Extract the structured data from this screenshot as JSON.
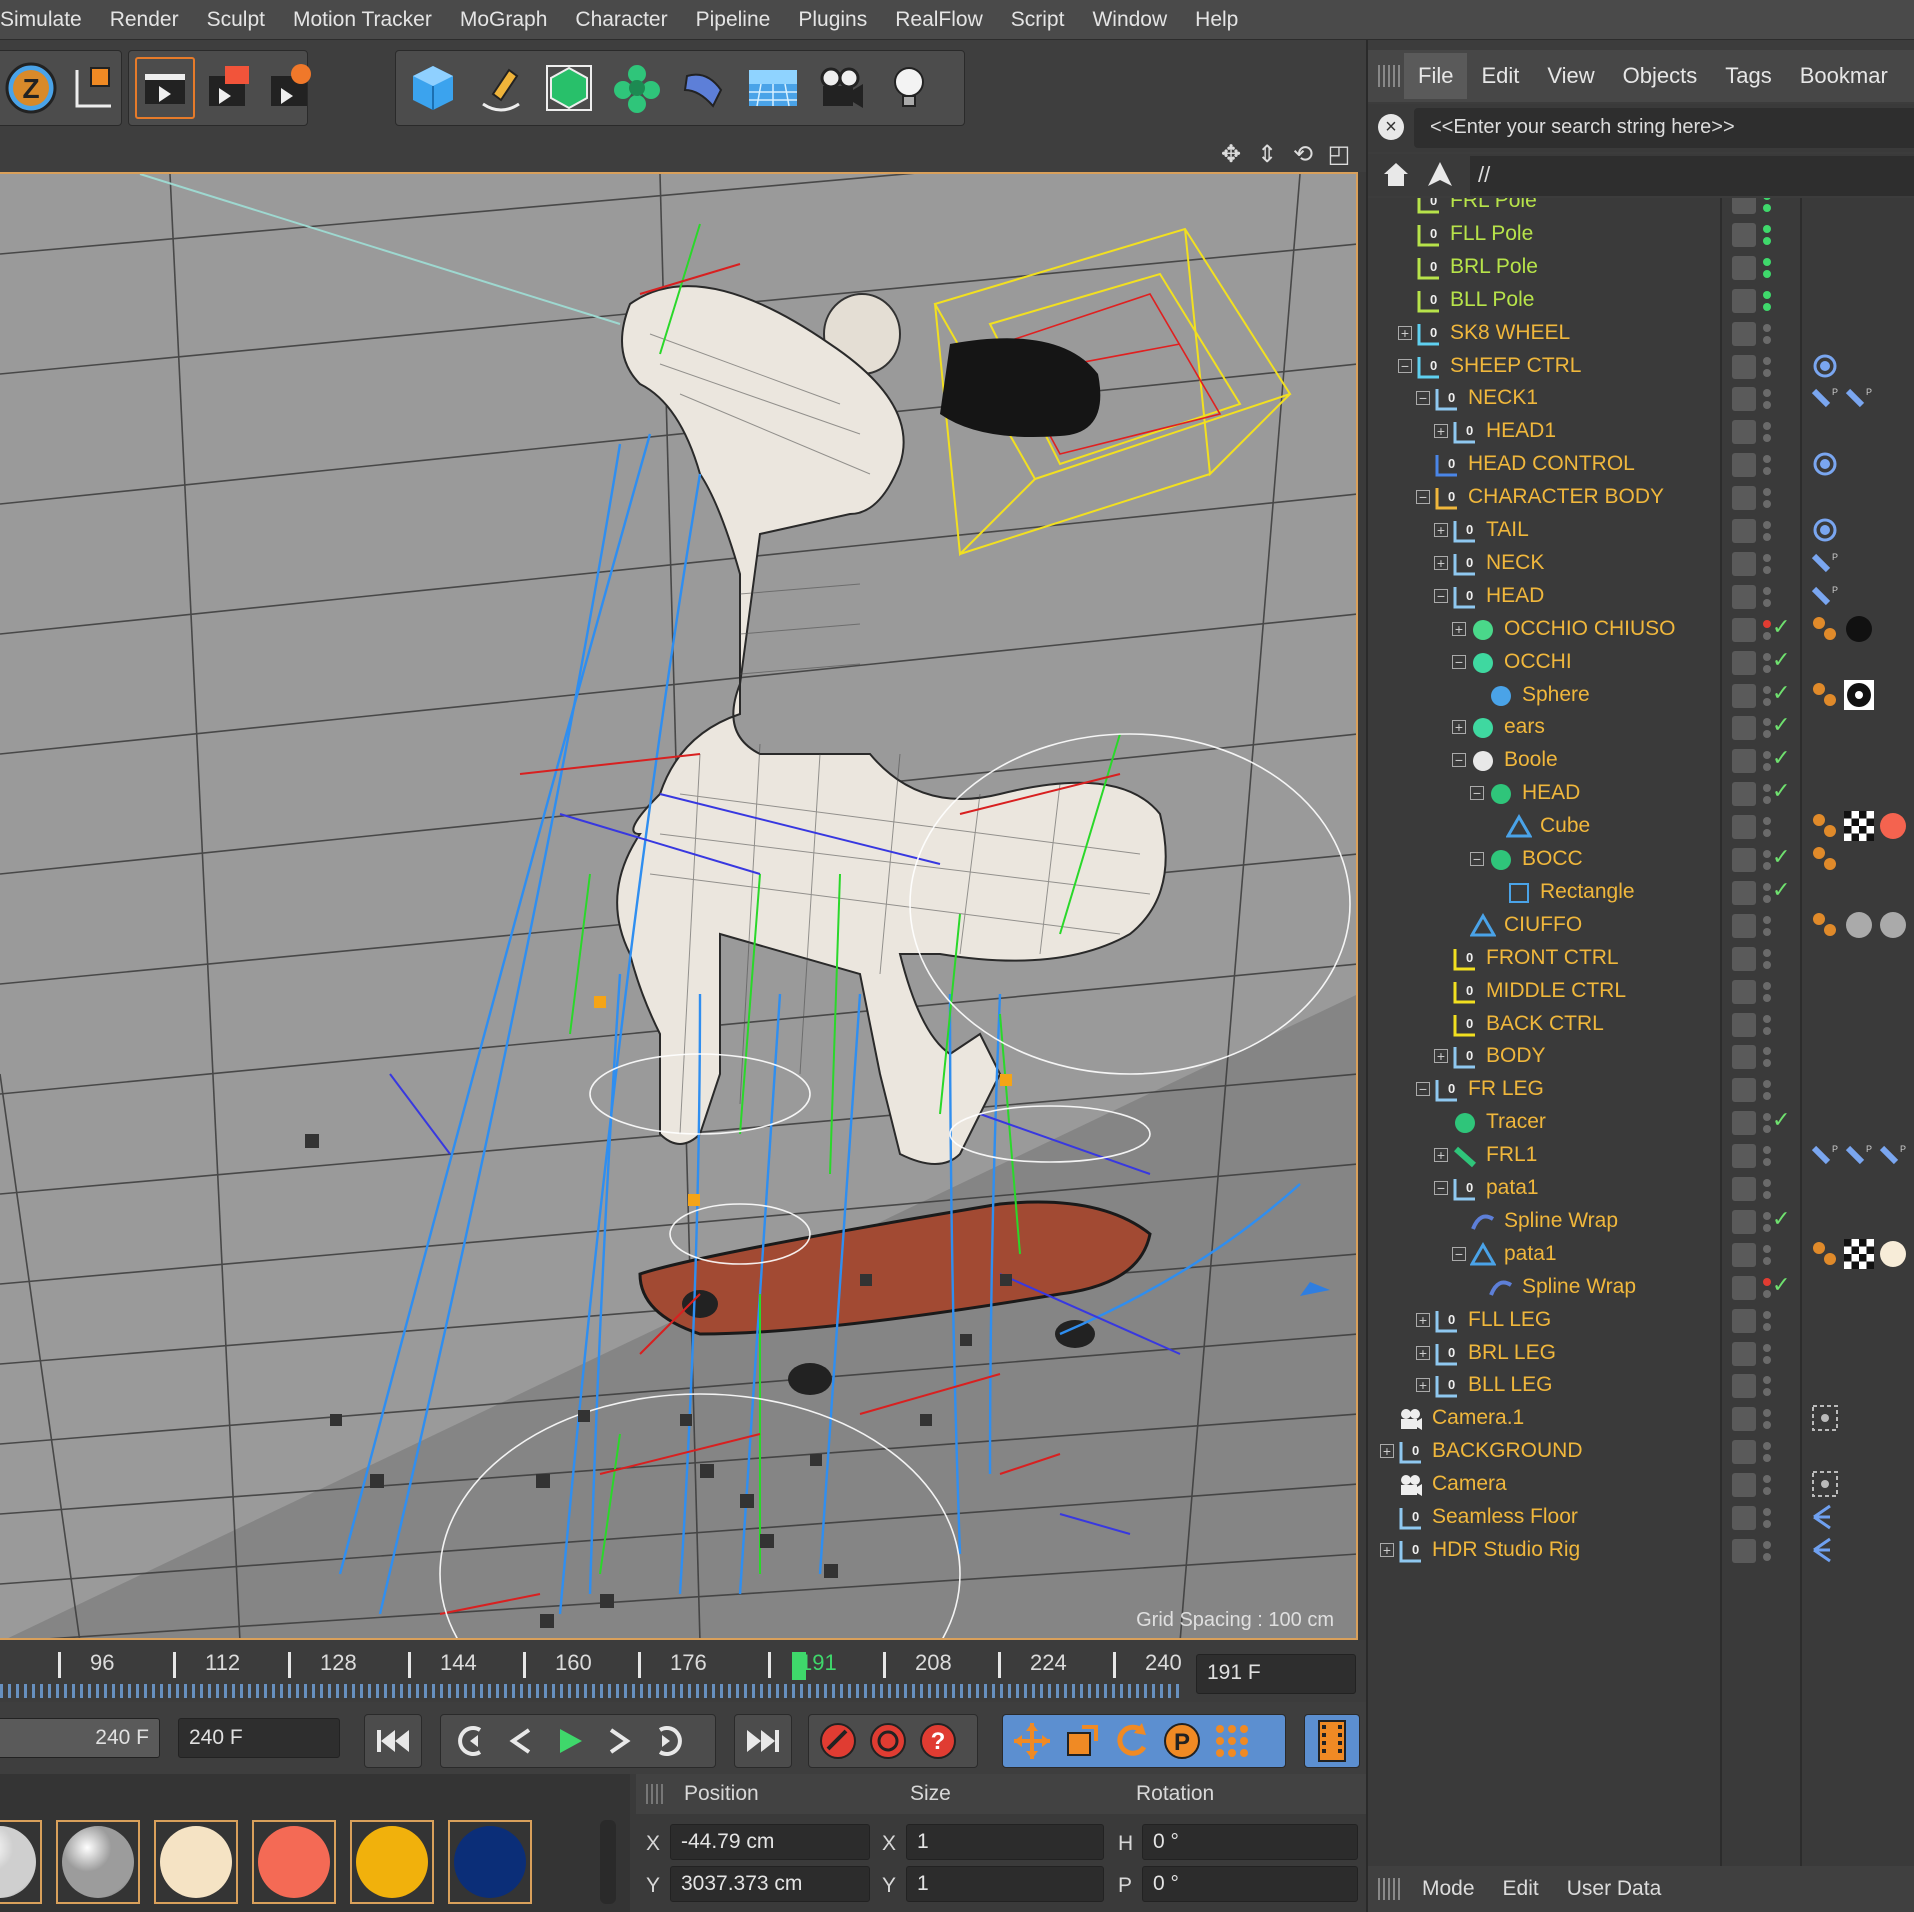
{
  "menu": [
    "Simulate",
    "Render",
    "Sculpt",
    "Motion Tracker",
    "MoGraph",
    "Character",
    "Pipeline",
    "Plugins",
    "RealFlow",
    "Script",
    "Window",
    "Help"
  ],
  "toolbar_icons": [
    "undo-z-icon",
    "coordinate-system-icon",
    "render-view-icon",
    "render-picture-icon",
    "render-settings-icon",
    "cube-primitive-icon",
    "pen-spline-icon",
    "subdivision-icon",
    "cloner-icon",
    "deformer-icon",
    "floor-icon",
    "camera-icon",
    "light-icon"
  ],
  "viewport": {
    "nav_icons": [
      "move-view-icon",
      "dolly-view-icon",
      "rotate-view-icon",
      "maximize-view-icon"
    ],
    "grid_spacing": "Grid Spacing : 100 cm",
    "accent": "#d9a05b",
    "background": "#9a9a9a"
  },
  "timeline": {
    "ticks": [
      "96",
      "112",
      "128",
      "144",
      "160",
      "176",
      "191",
      "208",
      "224",
      "240"
    ],
    "current_frame": "191",
    "current_frame_field": "191 F",
    "accent": "#3fd86b"
  },
  "transport": {
    "min_field": "240 F",
    "max_field": "240 F"
  },
  "materials": [
    {
      "name": "light-grey",
      "color": "#cfcfcf"
    },
    {
      "name": "grey",
      "color": "#9c9c9c"
    },
    {
      "name": "cream",
      "color": "#f5e3c4"
    },
    {
      "name": "coral",
      "color": "#f46a55"
    },
    {
      "name": "yellow",
      "color": "#f1b10c"
    },
    {
      "name": "navy",
      "color": "#0b2e78"
    }
  ],
  "attributes": {
    "headers": [
      "Position",
      "Size",
      "Rotation"
    ],
    "rows": [
      {
        "pos_label": "X",
        "pos_value": "-44.79 cm",
        "size_label": "X",
        "size_value": "1",
        "rot_label": "H",
        "rot_value": "0 °"
      },
      {
        "pos_label": "Y",
        "pos_value": "3037.373 cm",
        "size_label": "Y",
        "size_value": "1",
        "rot_label": "P",
        "rot_value": "0 °"
      }
    ]
  },
  "object_manager": {
    "menu": [
      "File",
      "Edit",
      "View",
      "Objects",
      "Tags",
      "Bookmar"
    ],
    "search_placeholder": "<<Enter your search string here>>",
    "path": "//",
    "bottom_tabs": [
      "Mode",
      "Edit",
      "User Data"
    ],
    "objects": [
      {
        "name": "FRL Pole",
        "indent": 1,
        "icon": "null-green",
        "color": "green",
        "expand": ""
      },
      {
        "name": "FLL Pole",
        "indent": 1,
        "icon": "null-green",
        "color": "green",
        "expand": ""
      },
      {
        "name": "BRL Pole",
        "indent": 1,
        "icon": "null-green",
        "color": "green",
        "expand": ""
      },
      {
        "name": "BLL Pole",
        "indent": 1,
        "icon": "null-green",
        "color": "green",
        "expand": ""
      },
      {
        "name": "SK8 WHEEL",
        "indent": 1,
        "icon": "null-cyan",
        "color": "orange",
        "expand": "+"
      },
      {
        "name": "SHEEP CTRL",
        "indent": 1,
        "icon": "null-cyan",
        "color": "orange",
        "expand": "-"
      },
      {
        "name": "NECK1",
        "indent": 2,
        "icon": "null",
        "color": "orange",
        "expand": "-"
      },
      {
        "name": "HEAD1",
        "indent": 3,
        "icon": "null",
        "color": "orange",
        "expand": "+"
      },
      {
        "name": "HEAD CONTROL",
        "indent": 2,
        "icon": "null-blue",
        "color": "orange",
        "expand": ""
      },
      {
        "name": "CHARACTER BODY",
        "indent": 2,
        "icon": "null-orange",
        "color": "orange",
        "expand": "-"
      },
      {
        "name": "TAIL",
        "indent": 3,
        "icon": "null",
        "color": "orange",
        "expand": "+"
      },
      {
        "name": "NECK",
        "indent": 3,
        "icon": "null",
        "color": "orange",
        "expand": "+"
      },
      {
        "name": "HEAD",
        "indent": 3,
        "icon": "null",
        "color": "orange",
        "expand": "-"
      },
      {
        "name": "OCCHIO CHIUSO",
        "indent": 4,
        "icon": "spline-green",
        "color": "orange",
        "expand": "+"
      },
      {
        "name": "OCCHI",
        "indent": 4,
        "icon": "symmetry",
        "color": "orange",
        "expand": "-"
      },
      {
        "name": "Sphere",
        "indent": 5,
        "icon": "sphere",
        "color": "orange",
        "expand": ""
      },
      {
        "name": "ears",
        "indent": 4,
        "icon": "symmetry",
        "color": "orange",
        "expand": "+"
      },
      {
        "name": "Boole",
        "indent": 4,
        "icon": "boole",
        "color": "orange",
        "expand": "-"
      },
      {
        "name": "HEAD",
        "indent": 5,
        "icon": "subdiv",
        "color": "orange",
        "expand": "-"
      },
      {
        "name": "Cube",
        "indent": 6,
        "icon": "polygon",
        "color": "orange",
        "expand": ""
      },
      {
        "name": "BOCC",
        "indent": 5,
        "icon": "extrude",
        "color": "orange",
        "expand": "-"
      },
      {
        "name": "Rectangle",
        "indent": 6,
        "icon": "rectangle",
        "color": "orange",
        "expand": ""
      },
      {
        "name": "CIUFFO",
        "indent": 4,
        "icon": "polygon",
        "color": "orange",
        "expand": ""
      },
      {
        "name": "FRONT CTRL",
        "indent": 3,
        "icon": "null-yellow",
        "color": "orange",
        "expand": ""
      },
      {
        "name": "MIDDLE CTRL",
        "indent": 3,
        "icon": "null-yellow",
        "color": "orange",
        "expand": ""
      },
      {
        "name": "BACK CTRL",
        "indent": 3,
        "icon": "null-yellow",
        "color": "orange",
        "expand": ""
      },
      {
        "name": "BODY",
        "indent": 3,
        "icon": "null",
        "color": "orange",
        "expand": "+"
      },
      {
        "name": "FR LEG",
        "indent": 2,
        "icon": "null",
        "color": "orange",
        "expand": "-"
      },
      {
        "name": "Tracer",
        "indent": 3,
        "icon": "tracer",
        "color": "orange",
        "expand": ""
      },
      {
        "name": "FRL1",
        "indent": 3,
        "icon": "joint",
        "color": "orange",
        "expand": "+"
      },
      {
        "name": "pata1",
        "indent": 3,
        "icon": "null",
        "color": "orange",
        "expand": "-"
      },
      {
        "name": "Spline Wrap",
        "indent": 4,
        "icon": "spline-wrap",
        "color": "orange",
        "expand": ""
      },
      {
        "name": "pata1",
        "indent": 4,
        "icon": "polygon",
        "color": "orange",
        "expand": "-"
      },
      {
        "name": "Spline Wrap",
        "indent": 5,
        "icon": "spline-wrap",
        "color": "orange",
        "expand": ""
      },
      {
        "name": "FLL LEG",
        "indent": 2,
        "icon": "null",
        "color": "orange",
        "expand": "+"
      },
      {
        "name": "BRL LEG",
        "indent": 2,
        "icon": "null",
        "color": "orange",
        "expand": "+"
      },
      {
        "name": "BLL LEG",
        "indent": 2,
        "icon": "null",
        "color": "orange",
        "expand": "+"
      },
      {
        "name": "Camera.1",
        "indent": 0,
        "icon": "camera",
        "color": "orange",
        "expand": ""
      },
      {
        "name": "BACKGROUND",
        "indent": 0,
        "icon": "null",
        "color": "orange",
        "expand": "+"
      },
      {
        "name": "Camera",
        "indent": 0,
        "icon": "camera",
        "color": "orange",
        "expand": ""
      },
      {
        "name": "Seamless Floor",
        "indent": 0,
        "icon": "null",
        "color": "orange",
        "expand": ""
      },
      {
        "name": "HDR Studio Rig",
        "indent": 0,
        "icon": "null",
        "color": "orange",
        "expand": "+"
      }
    ],
    "row_extras": {
      "5": {
        "tags": [
          "ik-tag-icon"
        ],
        "check": false
      },
      "6": {
        "tags": [
          "constraint-tag-icon",
          "ik-goal-tag-icon"
        ],
        "check": false
      },
      "8": {
        "tags": [
          "ik-tag-icon"
        ],
        "check": false
      },
      "10": {
        "tags": [
          "ik-tag-icon"
        ],
        "check": false
      },
      "11": {
        "tags": [
          "pose-tag-icon"
        ],
        "check": false
      },
      "12": {
        "tags": [
          "pose-tag-icon"
        ],
        "check": false
      },
      "13": {
        "tags": [
          "phong-tag-icon",
          "black-material-icon"
        ],
        "check": true,
        "red": true
      },
      "14": {
        "tags": [],
        "check": true
      },
      "15": {
        "tags": [
          "phong-tag-icon",
          "eye-material-icon"
        ],
        "check": true
      },
      "16": {
        "tags": [],
        "check": true
      },
      "17": {
        "tags": [],
        "check": true
      },
      "18": {
        "tags": [],
        "check": true
      },
      "19": {
        "tags": [
          "phong-tag-icon",
          "checker-material-icon",
          "coral-material-icon"
        ],
        "check": false
      },
      "20": {
        "tags": [
          "phong-tag-icon"
        ],
        "check": true
      },
      "21": {
        "tags": [],
        "check": true
      },
      "22": {
        "tags": [
          "phong-tag-icon",
          "grey-material-icon",
          "grey-material-icon"
        ],
        "check": false
      },
      "28": {
        "tags": [],
        "check": true
      },
      "29": {
        "tags": [
          "pose-tag-icon",
          "ik-goal-tag-icon",
          "ik-goal-tag-icon"
        ],
        "check": false
      },
      "31": {
        "tags": [],
        "check": true
      },
      "32": {
        "tags": [
          "phong-tag-icon",
          "checker-material-icon",
          "cream-material-icon"
        ],
        "check": false
      },
      "33": {
        "tags": [],
        "check": true,
        "red": true
      },
      "37": {
        "tags": [
          "target-tag-icon"
        ],
        "check": false
      },
      "39": {
        "tags": [
          "target-tag-icon"
        ],
        "check": false
      },
      "40": {
        "tags": [
          "xpresso-tag-icon"
        ],
        "check": false
      },
      "41": {
        "tags": [
          "xpresso-tag-icon"
        ],
        "check": false
      }
    }
  }
}
